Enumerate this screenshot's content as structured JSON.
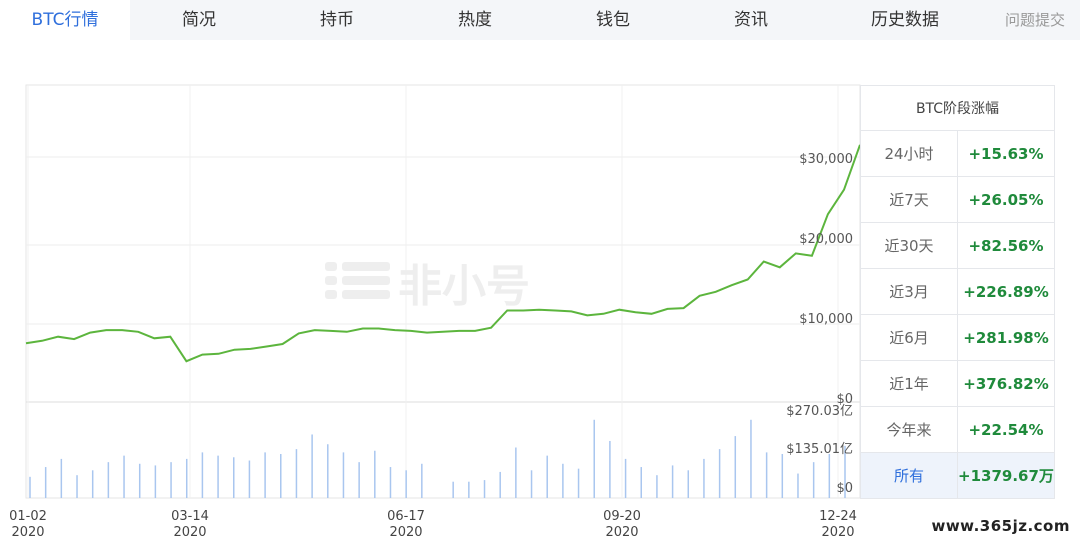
{
  "tabs": [
    {
      "label": "BTC行情",
      "active": true
    },
    {
      "label": "简况"
    },
    {
      "label": "持币"
    },
    {
      "label": "热度"
    },
    {
      "label": "钱包"
    },
    {
      "label": "资讯"
    },
    {
      "label": "历史数据"
    },
    {
      "label": "问题提交"
    }
  ],
  "watermark": "非小号",
  "site_watermark": "www.365jz.com",
  "colors": {
    "line": "#5cb53d",
    "volume": "#a9c6ef",
    "accent": "#2f6fdc",
    "positive": "#1f8a3b"
  },
  "stats": {
    "title": "BTC阶段涨幅",
    "rows": [
      {
        "label": "24小时",
        "value": "+15.63%"
      },
      {
        "label": "近7天",
        "value": "+26.05%"
      },
      {
        "label": "近30天",
        "value": "+82.56%"
      },
      {
        "label": "近3月",
        "value": "+226.89%"
      },
      {
        "label": "近6月",
        "value": "+281.98%"
      },
      {
        "label": "近1年",
        "value": "+376.82%"
      },
      {
        "label": "今年来",
        "value": "+22.54%"
      },
      {
        "label": "所有",
        "value": "+1379.67万",
        "highlight": true
      }
    ]
  },
  "chart_data": {
    "type": "line",
    "price_axis": {
      "ticks": [
        "$30,000",
        "$20,000",
        "$10,000",
        "$0"
      ],
      "ylim": [
        0,
        30000
      ]
    },
    "volume_axis": {
      "ticks": [
        "$270.03亿",
        "$135.01亿",
        "$0"
      ],
      "ylim": [
        0,
        270.03
      ]
    },
    "x_ticks": [
      {
        "date": "01-02",
        "year": "2020"
      },
      {
        "date": "03-14",
        "year": "2020"
      },
      {
        "date": "06-17",
        "year": "2020"
      },
      {
        "date": "09-20",
        "year": "2020"
      },
      {
        "date": "12-24",
        "year": "2020"
      }
    ],
    "price_series": [
      7200,
      7500,
      8000,
      7700,
      8500,
      8800,
      8800,
      8600,
      7800,
      8000,
      5000,
      5800,
      5900,
      6400,
      6500,
      6800,
      7100,
      8400,
      8800,
      8700,
      8600,
      9000,
      9000,
      8800,
      8700,
      8500,
      8600,
      8700,
      8700,
      9100,
      11200,
      11200,
      11300,
      11200,
      11100,
      10600,
      10800,
      11300,
      11000,
      10800,
      11400,
      11500,
      13000,
      13500,
      14300,
      15000,
      17200,
      16500,
      18200,
      17900,
      23000,
      26000,
      31500
    ],
    "volume_series": [
      65,
      95,
      120,
      70,
      85,
      110,
      130,
      105,
      100,
      110,
      120,
      140,
      130,
      125,
      115,
      140,
      135,
      150,
      195,
      165,
      140,
      110,
      145,
      95,
      85,
      105,
      0,
      50,
      50,
      55,
      80,
      155,
      85,
      130,
      105,
      90,
      240,
      175,
      120,
      95,
      70,
      100,
      85,
      120,
      150,
      190,
      240,
      140,
      135,
      75,
      110,
      135,
      160
    ],
    "grid": true,
    "ylabel": "",
    "xlabel": ""
  }
}
